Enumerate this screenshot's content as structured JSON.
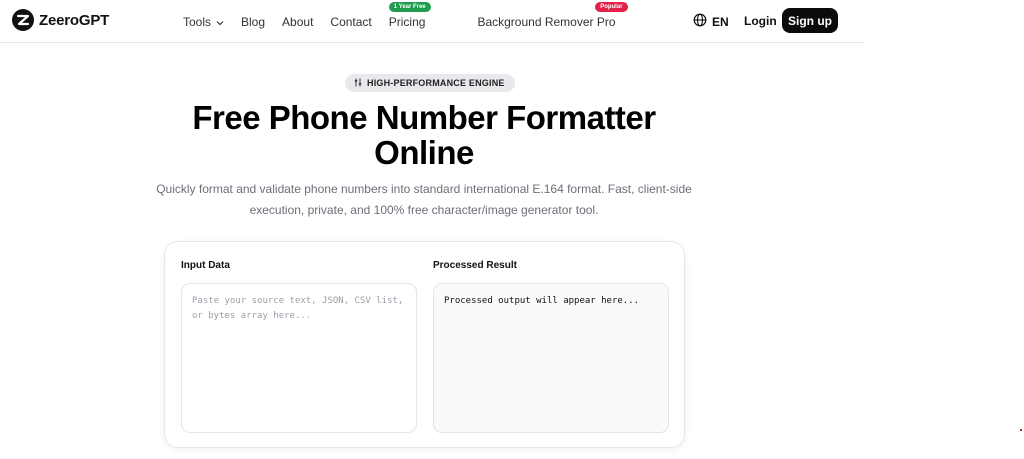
{
  "header": {
    "logo_text": "ZeeroGPT",
    "nav": {
      "tools": "Tools",
      "blog": "Blog",
      "about": "About",
      "contact": "Contact",
      "pricing": "Pricing",
      "pricing_badge": "1 Year Free",
      "bg_remover": "Background Remover Pro",
      "bg_remover_badge": "Popular"
    },
    "language": "EN",
    "login": "Login",
    "signup": "Sign up"
  },
  "hero": {
    "badge": "HIGH-PERFORMANCE ENGINE",
    "title_line1": "Free Phone Number Formatter",
    "title_line2": "Online",
    "subtitle_line1": "Quickly format and validate phone numbers into standard international E.164 format. Fast, client-side",
    "subtitle_line2": "execution, private, and 100% free character/image generator tool."
  },
  "tool": {
    "input_label": "Input Data",
    "input_placeholder": "Paste your source text, JSON, CSV list, or bytes array here...",
    "output_label": "Processed Result",
    "output_placeholder": "Processed output will appear here..."
  },
  "colors": {
    "primary": "#0b0b0b",
    "badge_green": "#1f9d4d",
    "badge_red": "#e0214a",
    "muted_text": "#6b6f78"
  }
}
